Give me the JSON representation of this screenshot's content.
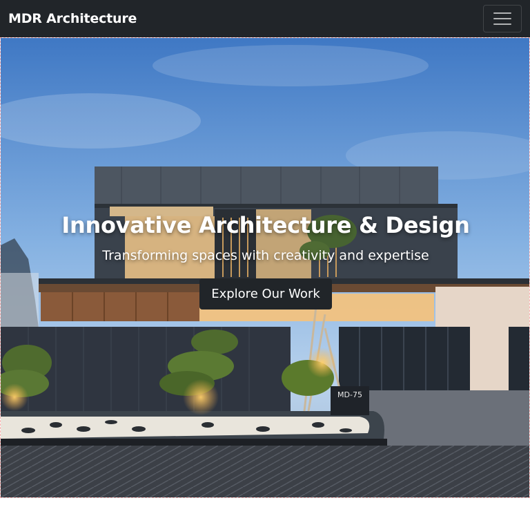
{
  "navbar": {
    "brand": "MDR Architecture",
    "menu_icon": "hamburger-icon"
  },
  "hero": {
    "title": "Innovative Architecture & Design",
    "subtitle": "Transforming spaces with creativity and expertise",
    "cta_label": "Explore Our Work",
    "house_plate": "MD-75"
  },
  "colors": {
    "navbar_bg": "#212529",
    "button_bg": "#212529",
    "text": "#ffffff"
  }
}
